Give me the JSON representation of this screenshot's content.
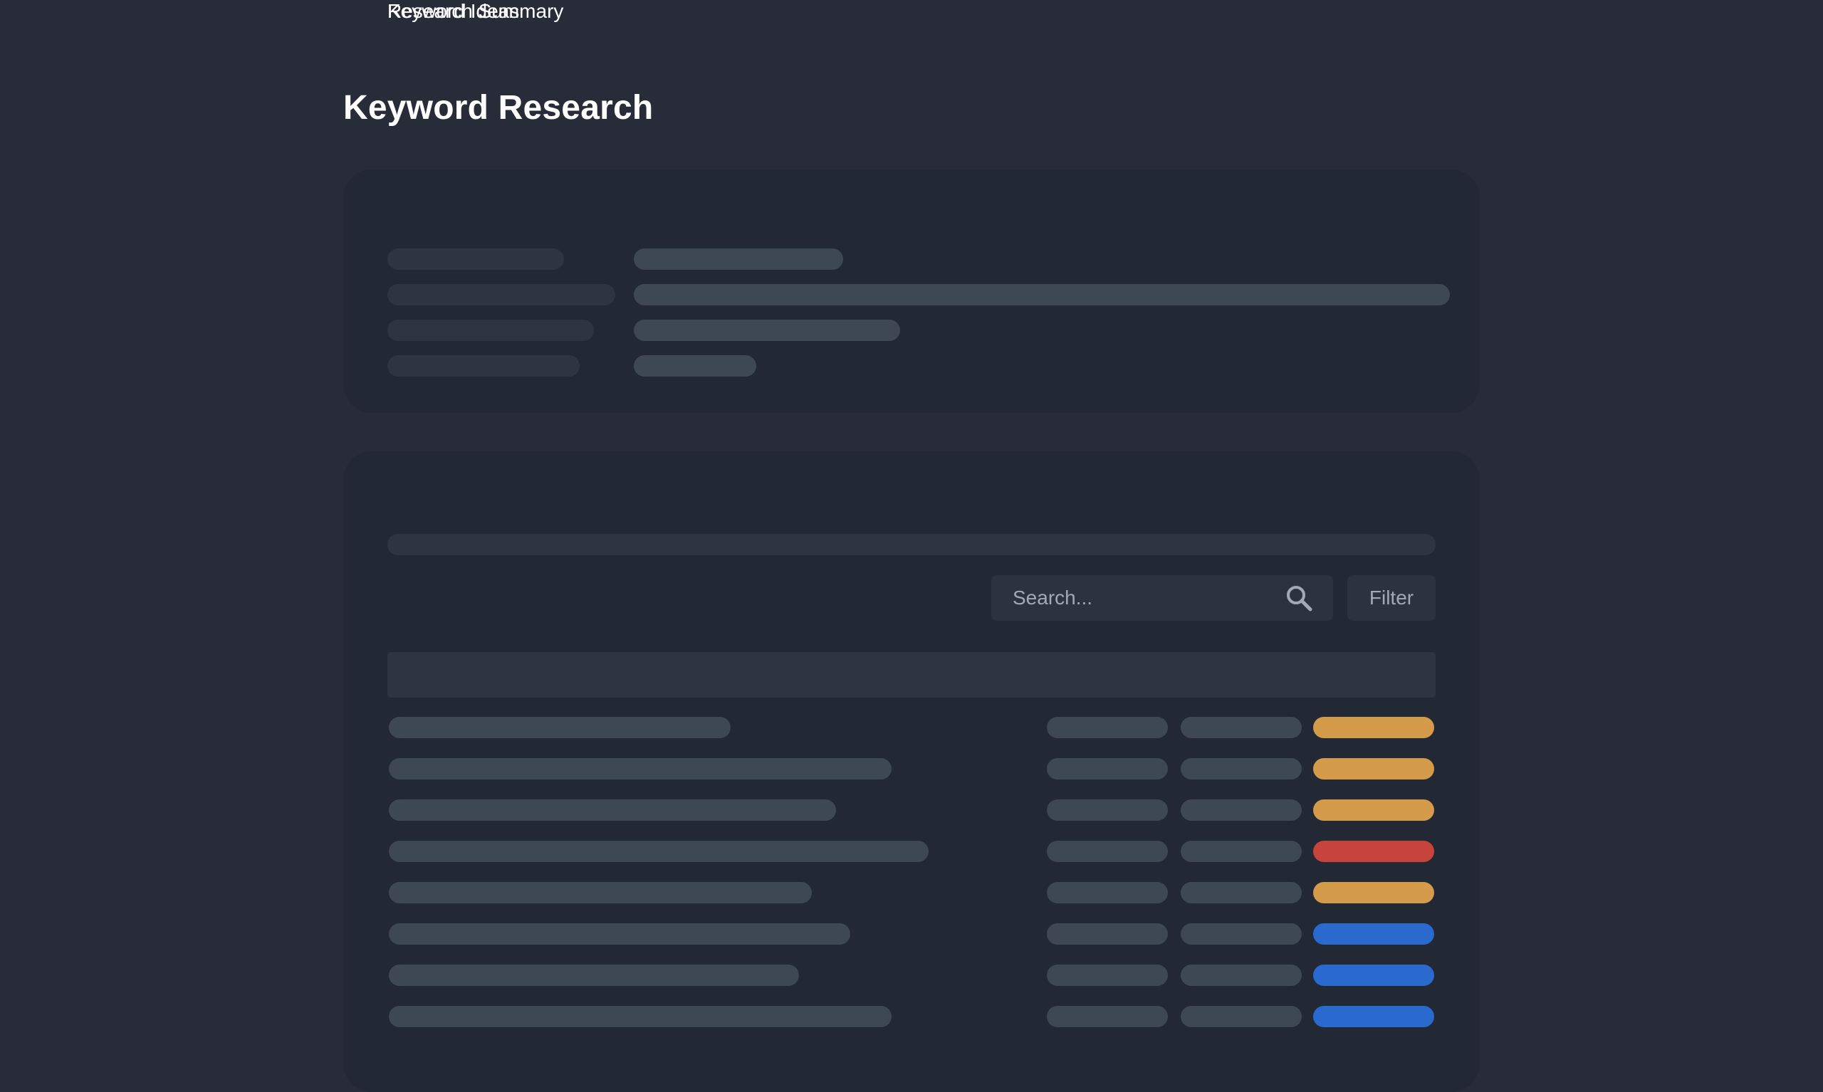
{
  "page": {
    "title": "Keyword Research"
  },
  "summary": {
    "title": "Research Summary"
  },
  "ideas": {
    "title": "Keyword Ideas",
    "search": {
      "placeholder": "Search..."
    },
    "filter_label": "Filter",
    "rows": [
      {
        "status_color": "#d39b4a"
      },
      {
        "status_color": "#d39b4a"
      },
      {
        "status_color": "#d39b4a"
      },
      {
        "status_color": "#c7443d"
      },
      {
        "status_color": "#d39b4a"
      },
      {
        "status_color": "#2a6acf"
      },
      {
        "status_color": "#2a6acf"
      },
      {
        "status_color": "#2a6acf"
      }
    ]
  },
  "colors": {
    "background": "#272c38",
    "card": "#232835",
    "skeleton": "#3d4854",
    "skeleton_dim": "#2e3441",
    "status_gold": "#d39b4a",
    "status_red": "#c7443d",
    "status_blue": "#2a6acf"
  },
  "icons": [
    "search-icon"
  ]
}
